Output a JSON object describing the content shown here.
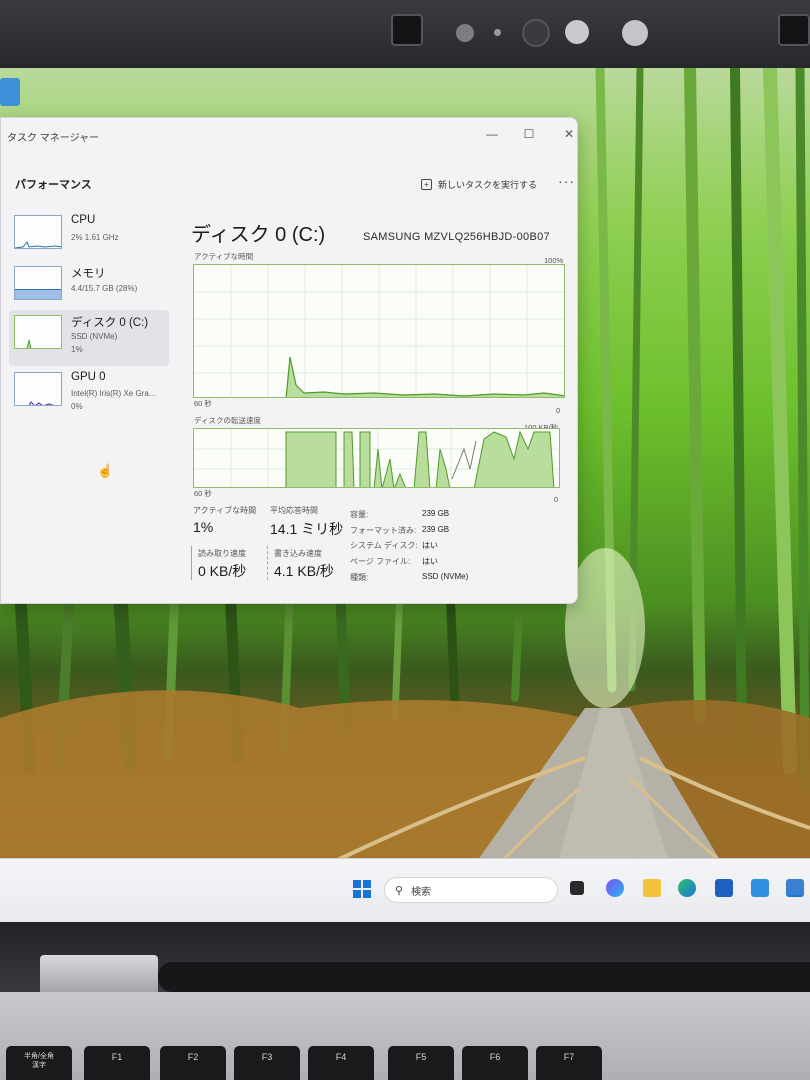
{
  "window": {
    "title": "タスク マネージャー",
    "controls": [
      "—",
      "☐",
      "✕"
    ]
  },
  "header": {
    "section": "パフォーマンス",
    "run_task": "新しいタスクを実行する",
    "more": "···"
  },
  "sidebar": {
    "items": [
      {
        "name": "CPU",
        "sub1": "2% 1.61 GHz",
        "sub2": ""
      },
      {
        "name": "メモリ",
        "sub1": "4.4/15.7 GB (28%)",
        "sub2": ""
      },
      {
        "name": "ディスク 0 (C:)",
        "sub1": "SSD (NVMe)",
        "sub2": "1%"
      },
      {
        "name": "GPU 0",
        "sub1": "Intel(R) Iris(R) Xe Gra...",
        "sub2": "0%"
      }
    ]
  },
  "main": {
    "title": "ディスク 0 (C:)",
    "model": "SAMSUNG MZVLQ256HBJD-00B07",
    "graph1": {
      "label": "アクティブな時間",
      "max": "100%",
      "time": "60 秒",
      "min": "0"
    },
    "graph2": {
      "label": "ディスクの転送速度",
      "max": "100 KB/秒",
      "time": "60 秒",
      "min": "0"
    },
    "stats": {
      "active_label": "アクティブな時間",
      "active_value": "1%",
      "resp_label": "平均応答時間",
      "resp_value": "14.1 ミリ秒",
      "read_label": "読み取り速度",
      "read_value": "0 KB/秒",
      "write_label": "書き込み速度",
      "write_value": "4.1 KB/秒"
    },
    "props": [
      {
        "k": "容量:",
        "v": "239 GB"
      },
      {
        "k": "フォーマット済み:",
        "v": "239 GB"
      },
      {
        "k": "システム ディスク:",
        "v": "はい"
      },
      {
        "k": "ページ ファイル:",
        "v": "はい"
      },
      {
        "k": "種類:",
        "v": "SSD (NVMe)"
      }
    ],
    "colors": {
      "graph_line": "#4f9a2a",
      "graph_fill": "#b9dd9c",
      "graph_border": "#8fbc6a",
      "cpu_line": "#2f6fb3"
    }
  },
  "taskbar": {
    "search_placeholder": "検索",
    "icons": [
      "windows-start-icon",
      "search-icon",
      "task-view-icon",
      "copilot-icon",
      "file-explorer-icon",
      "edge-icon",
      "store-icon",
      "app-icon",
      "task-manager-icon"
    ]
  },
  "keyboard": {
    "keys": [
      "半角/全角\n漢字",
      "F1",
      "F2",
      "F3",
      "F4",
      "F5",
      "F6",
      "F7"
    ]
  }
}
